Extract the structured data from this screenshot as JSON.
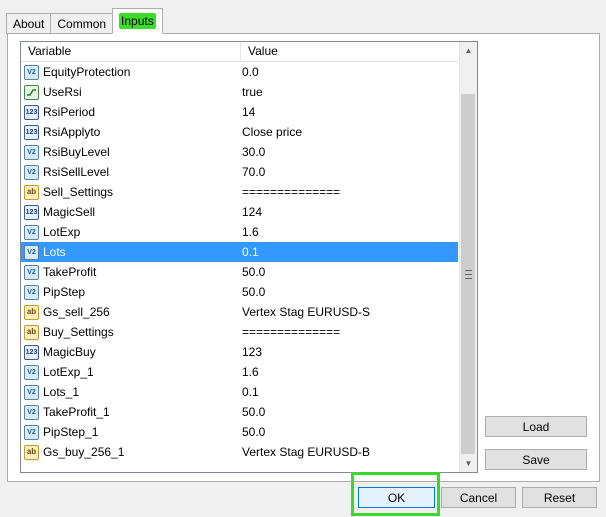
{
  "tabs": [
    {
      "label": "About"
    },
    {
      "label": "Common"
    },
    {
      "label": "Inputs"
    }
  ],
  "grid": {
    "columns": {
      "variable": "Variable",
      "value": "Value"
    },
    "rows": [
      {
        "type": "double",
        "name": "EquityProtection",
        "value": "0.0"
      },
      {
        "type": "bool",
        "name": "UseRsi",
        "value": "true"
      },
      {
        "type": "int",
        "name": "RsiPeriod",
        "value": "14"
      },
      {
        "type": "int",
        "name": "RsiApplyto",
        "value": "Close price"
      },
      {
        "type": "double",
        "name": "RsiBuyLevel",
        "value": "30.0"
      },
      {
        "type": "double",
        "name": "RsiSellLevel",
        "value": "70.0"
      },
      {
        "type": "string",
        "name": "Sell_Settings",
        "value": "=============="
      },
      {
        "type": "int",
        "name": "MagicSell",
        "value": "124"
      },
      {
        "type": "double",
        "name": "LotExp",
        "value": "1.6"
      },
      {
        "type": "double",
        "name": "Lots",
        "value": "0.1",
        "selected": true
      },
      {
        "type": "double",
        "name": "TakeProfit",
        "value": "50.0"
      },
      {
        "type": "double",
        "name": "PipStep",
        "value": "50.0"
      },
      {
        "type": "string",
        "name": "Gs_sell_256",
        "value": "Vertex Stag EURUSD-S"
      },
      {
        "type": "string",
        "name": "Buy_Settings",
        "value": "=============="
      },
      {
        "type": "int",
        "name": "MagicBuy",
        "value": "123"
      },
      {
        "type": "double",
        "name": "LotExp_1",
        "value": "1.6"
      },
      {
        "type": "double",
        "name": "Lots_1",
        "value": "0.1"
      },
      {
        "type": "double",
        "name": "TakeProfit_1",
        "value": "50.0"
      },
      {
        "type": "double",
        "name": "PipStep_1",
        "value": "50.0"
      },
      {
        "type": "string",
        "name": "Gs_buy_256_1",
        "value": "Vertex Stag EURUSD-B"
      }
    ]
  },
  "icons": {
    "double": {
      "glyph": "V2",
      "semantic": "double-type-icon"
    },
    "int": {
      "glyph": "123",
      "semantic": "integer-type-icon"
    },
    "string": {
      "glyph": "ab",
      "semantic": "string-type-icon"
    },
    "bool": {
      "semantic": "boolean-type-icon"
    }
  },
  "buttons": {
    "load": "Load",
    "save": "Save",
    "ok": "OK",
    "cancel": "Cancel",
    "reset": "Reset"
  },
  "colors": {
    "selection": "#3399ff",
    "highlight": "#39d92a"
  }
}
